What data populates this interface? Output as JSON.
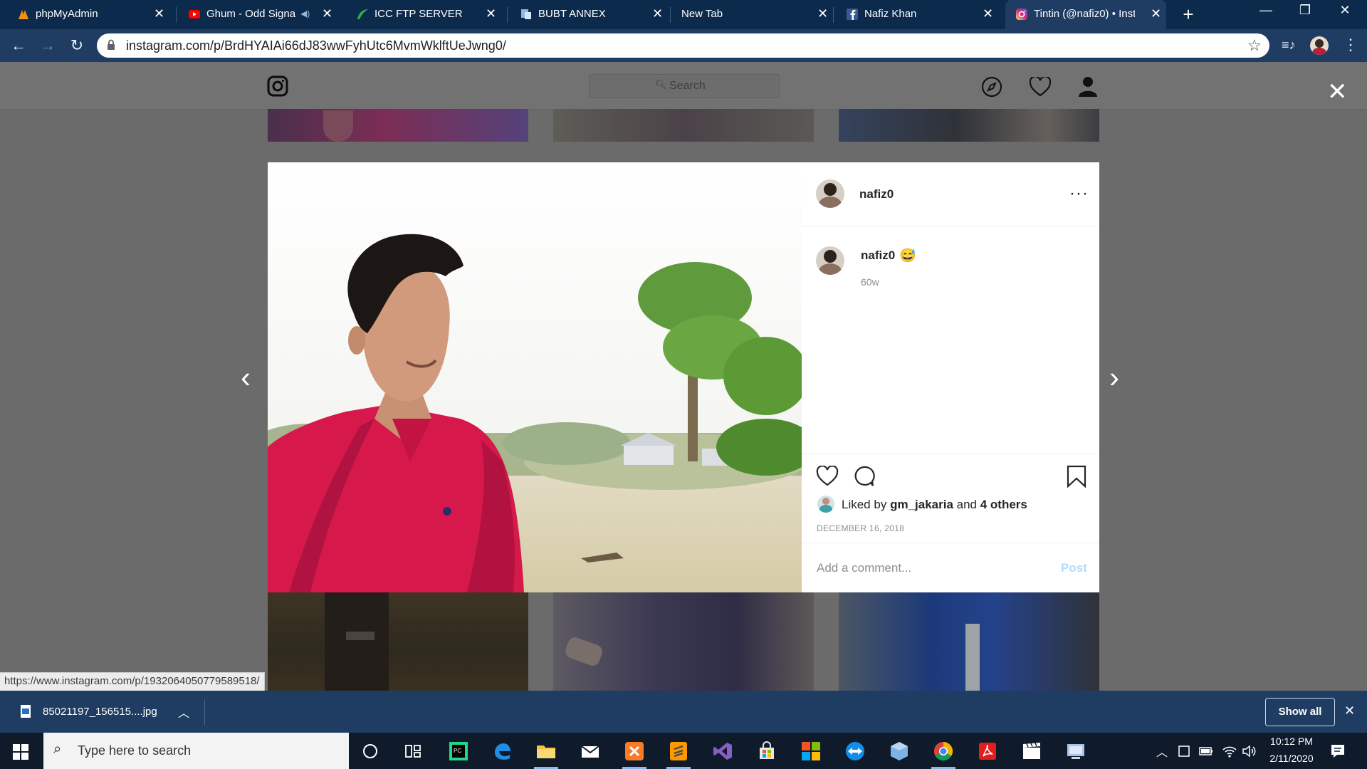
{
  "browser": {
    "tabs": [
      {
        "title": "phpMyAdmin",
        "icon": "phpmyadmin-icon"
      },
      {
        "title": "Ghum - Odd Signa",
        "icon": "youtube-icon",
        "muted_icon": "speaker-icon"
      },
      {
        "title": "ICC FTP SERVER",
        "icon": "leaf-icon"
      },
      {
        "title": "BUBT ANNEX",
        "icon": "document-icon"
      },
      {
        "title": "New Tab",
        "icon": ""
      },
      {
        "title": "Nafiz Khan",
        "icon": "facebook-icon"
      },
      {
        "title": "Tintin (@nafiz0) • Insta",
        "icon": "instagram-icon"
      }
    ],
    "address": "instagram.com/p/BrdHYAIAi66dJ83wwFyhUtc6MvmWklftUeJwng0/",
    "status_url": "https://www.instagram.com/p/1932064050779589518/"
  },
  "instagram": {
    "search_placeholder": "Search",
    "post": {
      "username": "nafiz0",
      "caption_user": "nafiz0",
      "caption_emoji": "😅",
      "age": "60w",
      "liked_prefix": "Liked by",
      "liked_user": "gm_jakaria",
      "liked_and": "and",
      "liked_others": "4 others",
      "date": "DECEMBER 16, 2018",
      "comment_placeholder": "Add a comment...",
      "post_label": "Post"
    }
  },
  "download": {
    "filename": "85021197_156515....jpg",
    "show_all": "Show all"
  },
  "taskbar": {
    "search_placeholder": "Type here to search",
    "time": "10:12 PM",
    "date": "2/11/2020"
  },
  "colors": {
    "tabstrip": "#0c2a4b",
    "toolbar": "#1f3d63",
    "overlay": "#6b6b6b",
    "post_link": "#b3dbff"
  }
}
